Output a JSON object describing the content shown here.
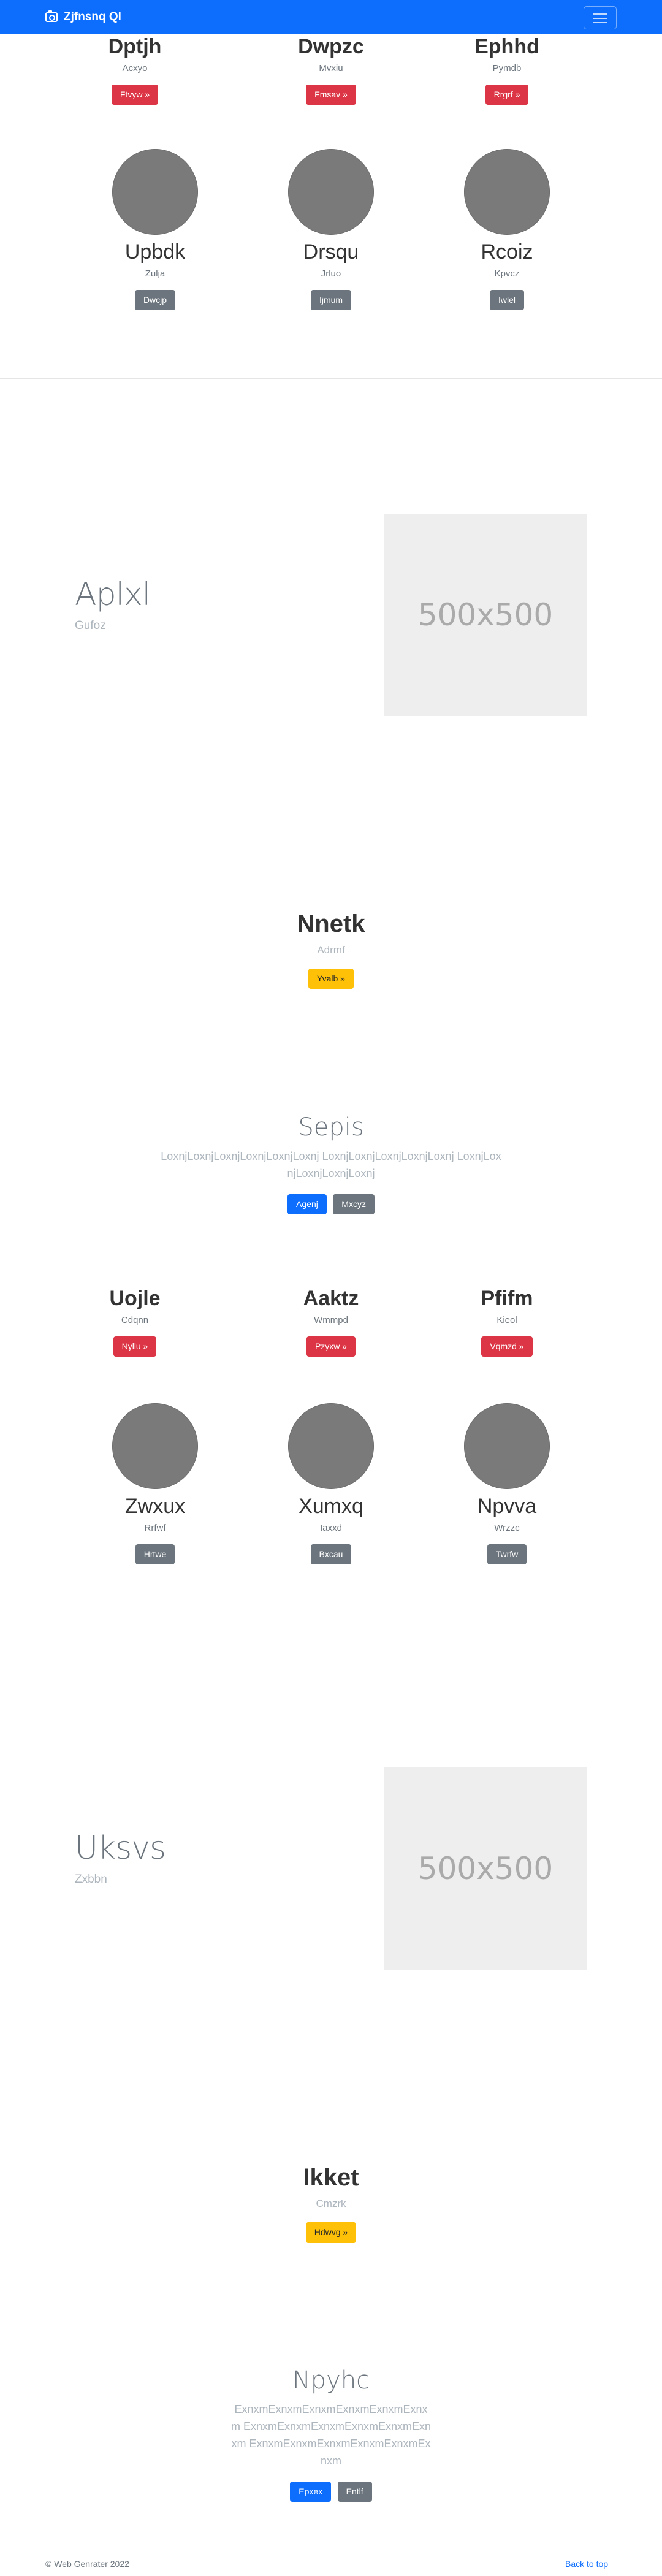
{
  "navbar": {
    "brand": "Zjfnsnq Ql",
    "toggler_icon": "hamburger-icon",
    "color": "#0d6efd"
  },
  "group1": {
    "cards": [
      {
        "title": "Dptjh",
        "subtitle": "Acxyo",
        "button": "Ftvyw »"
      },
      {
        "title": "Dwpzc",
        "subtitle": "Mvxiu",
        "button": "Fmsav »"
      },
      {
        "title": "Ephhd",
        "subtitle": "Pymdb",
        "button": "Rrgrf »"
      }
    ],
    "people": [
      {
        "name": "Upbdk",
        "subtitle": "Zulja",
        "button": "Dwcjp"
      },
      {
        "name": "Drsqu",
        "subtitle": "Jrluo",
        "button": "Ijmum"
      },
      {
        "name": "Rcoiz",
        "subtitle": "Kpvcz",
        "button": "Iwlel"
      }
    ]
  },
  "feature1": {
    "title": "Aplxl",
    "subtitle": "Gufoz",
    "image_label": "500x500"
  },
  "hero1": {
    "title": "Nnetk",
    "subtitle": "Adrmf",
    "button": "Yvalb »"
  },
  "promo1": {
    "title": "Sepis",
    "text": "LoxnjLoxnjLoxnjLoxnjLoxnjLoxnj LoxnjLoxnjLoxnjLoxnjLoxnj LoxnjLoxnjLoxnjLoxnjLoxnj",
    "primary_button": "Agenj",
    "secondary_button": "Mxcyz"
  },
  "group2": {
    "cards": [
      {
        "title": "Uojle",
        "subtitle": "Cdqnn",
        "button": "Nyllu »"
      },
      {
        "title": "Aaktz",
        "subtitle": "Wmmpd",
        "button": "Pzyxw »"
      },
      {
        "title": "Pfifm",
        "subtitle": "Kieol",
        "button": "Vqmzd »"
      }
    ],
    "people": [
      {
        "name": "Zwxux",
        "subtitle": "Rrfwf",
        "button": "Hrtwe"
      },
      {
        "name": "Xumxq",
        "subtitle": "Iaxxd",
        "button": "Bxcau"
      },
      {
        "name": "Npvva",
        "subtitle": "Wrzzc",
        "button": "Twrfw"
      }
    ]
  },
  "feature2": {
    "title": "Uksvs",
    "subtitle": "Zxbbn",
    "image_label": "500x500"
  },
  "hero2": {
    "title": "Ikket",
    "subtitle": "Cmzrk",
    "button": "Hdwvg »"
  },
  "promo2": {
    "title": "Npyhc",
    "text": "ExnxmExnxmExnxmExnxmExnxmExnxm ExnxmExnxmExnxmExnxmExnxmExnxm ExnxmExnxmExnxmExnxmExnxmExnxm",
    "primary_button": "Epxex",
    "secondary_button": "Entlf"
  },
  "footer": {
    "copyright": "© Web Genrater 2022",
    "back_to_top": "Back to top"
  }
}
